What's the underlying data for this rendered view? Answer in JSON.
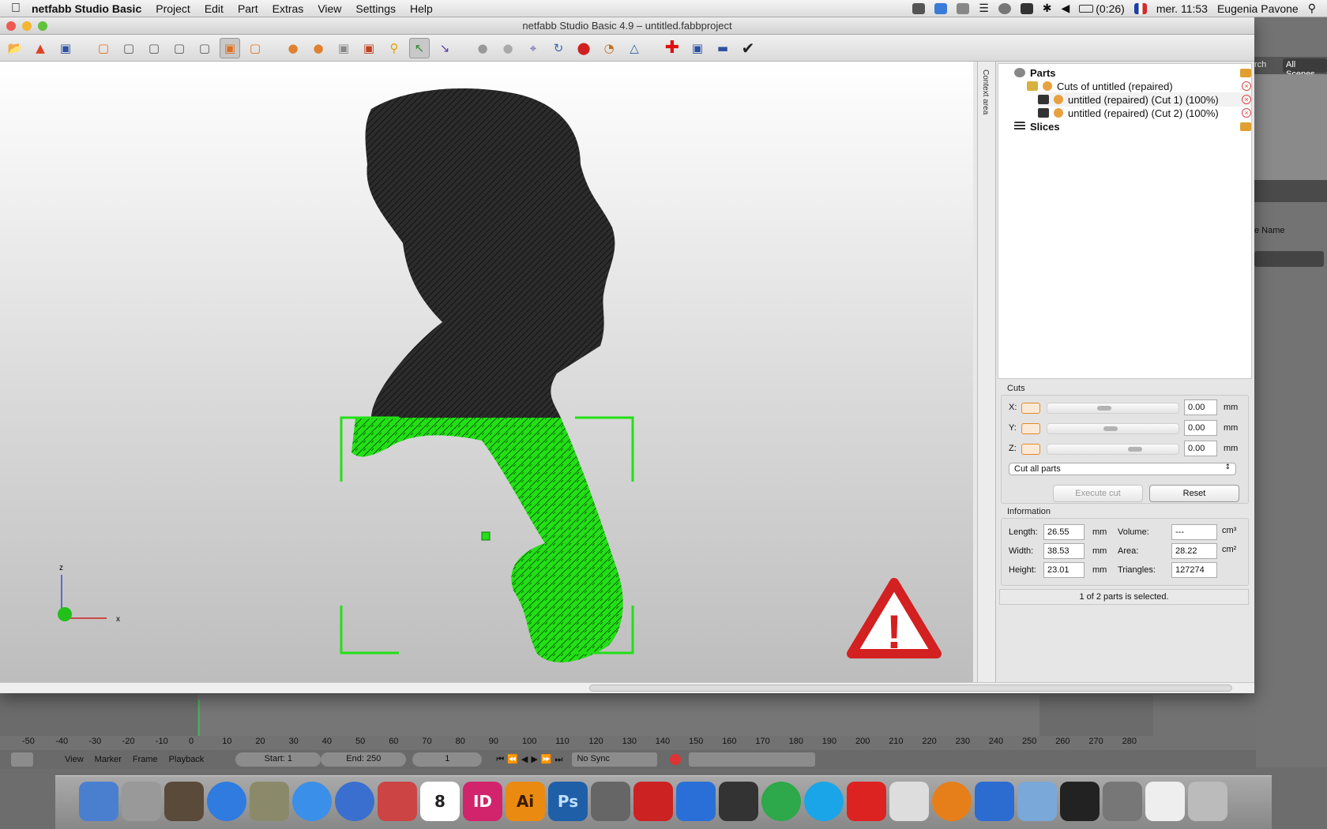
{
  "menubar": {
    "app_name": "netfabb Studio Basic",
    "menus": [
      "Project",
      "Edit",
      "Part",
      "Extras",
      "View",
      "Settings",
      "Help"
    ],
    "battery": "(0:26)",
    "clock": "mer. 11:53",
    "user": "Eugenia Pavone"
  },
  "window": {
    "title": "netfabb Studio Basic 4.9 – untitled.fabbproject",
    "context_tab": "Context area"
  },
  "tree": {
    "parts_label": "Parts",
    "group_label": "Cuts of untitled (repaired)",
    "items": [
      {
        "label": "untitled (repaired) (Cut 1) (100%)"
      },
      {
        "label": "untitled (repaired) (Cut 2) (100%)"
      }
    ],
    "slices_label": "Slices"
  },
  "cuts": {
    "title": "Cuts",
    "axes": [
      {
        "axis": "X:",
        "value": "0.00",
        "unit": "mm",
        "knob_fraction": 0.42
      },
      {
        "axis": "Y:",
        "value": "0.00",
        "unit": "mm",
        "knob_fraction": 0.47
      },
      {
        "axis": "Z:",
        "value": "0.00",
        "unit": "mm",
        "knob_fraction": 0.68
      }
    ],
    "mode": "Cut all parts",
    "execute_label": "Execute cut",
    "reset_label": "Reset"
  },
  "info": {
    "title": "Information",
    "length_label": "Length:",
    "length": "26.55",
    "width_label": "Width:",
    "width": "38.53",
    "height_label": "Height:",
    "height": "23.01",
    "unit_mm": "mm",
    "volume_label": "Volume:",
    "volume": "---",
    "volume_unit": "cm³",
    "area_label": "Area:",
    "area": "28.22",
    "area_unit": "cm²",
    "triangles_label": "Triangles:",
    "triangles": "127274",
    "status": "1 of 2 parts is selected."
  },
  "viewport": {
    "axis_z": "z",
    "axis_x": "x",
    "warning_symbol": "!"
  },
  "blender": {
    "all_scenes": "All Scenes",
    "search_fragment": "rch",
    "name_fragment": "e Name",
    "ruler": [
      "-50",
      "-40",
      "-30",
      "-20",
      "-10",
      "0",
      "10",
      "20",
      "30",
      "40",
      "50",
      "60",
      "70",
      "80",
      "90",
      "100",
      "110",
      "120",
      "130",
      "140",
      "150",
      "160",
      "170",
      "180",
      "190",
      "200",
      "210",
      "220",
      "230",
      "240",
      "250",
      "260",
      "270",
      "280"
    ],
    "view": "View",
    "marker": "Marker",
    "frame": "Frame",
    "playback": "Playback",
    "start": "Start: 1",
    "end": "End: 250",
    "current": "1",
    "sync": "No Sync"
  },
  "dock": {
    "labels": {
      "calendar_day": "8",
      "indesign": "ID",
      "illustrator": "Ai",
      "photoshop": "Ps"
    }
  },
  "colors": {
    "accent_green": "#22e015",
    "warning_red": "#d32020",
    "orange": "#e58a2a"
  }
}
